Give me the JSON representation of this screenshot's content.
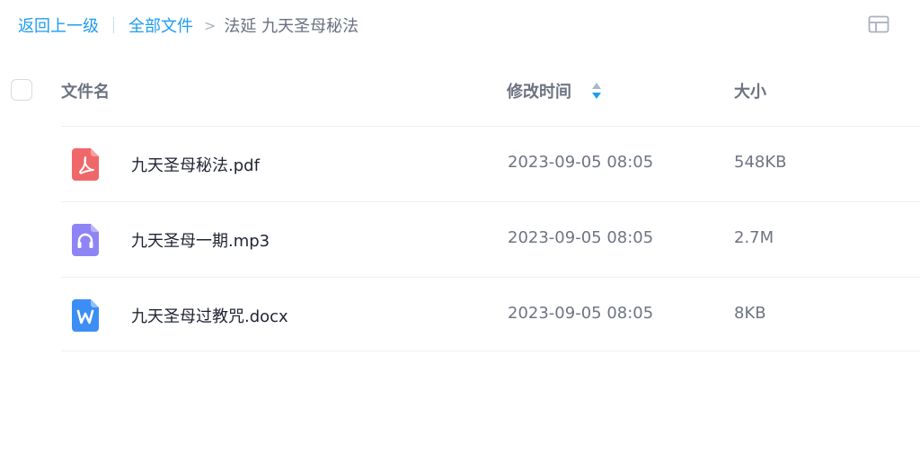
{
  "breadcrumb": {
    "back": "返回上一级",
    "all_files": "全部文件",
    "separator": ">",
    "current": "法延 九天圣母秘法"
  },
  "view_toggle_icon": "grid-view-icon",
  "table": {
    "columns": {
      "name": "文件名",
      "modified": "修改时间",
      "size": "大小"
    },
    "sort": {
      "column": "修改时间",
      "icon": "sort-icon"
    },
    "rows": [
      {
        "name": "九天圣母秘法.pdf",
        "modified": "2023-09-05 08:05",
        "size": "548KB",
        "icon": "pdf-file-icon",
        "icon_color": "#f0676a"
      },
      {
        "name": "九天圣母一期.mp3",
        "modified": "2023-09-05 08:05",
        "size": "2.7M",
        "icon": "audio-file-icon",
        "icon_color": "#8f84f5"
      },
      {
        "name": "九天圣母过教咒.docx",
        "modified": "2023-09-05 08:05",
        "size": "8KB",
        "icon": "word-file-icon",
        "icon_color": "#3c8ef5"
      }
    ]
  },
  "colors": {
    "link": "#1f9cf0",
    "sort_active": "#1f9cf0"
  }
}
